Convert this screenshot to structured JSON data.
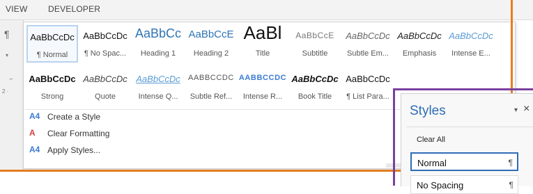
{
  "ribbon": {
    "tabs": [
      "VIEW",
      "DEVELOPER"
    ],
    "left_glyphs": {
      "paragraph": "¶",
      "dropdown": "▾",
      "launcher": "⌐",
      "ruler": "2 ·"
    }
  },
  "gallery": {
    "row1": [
      {
        "preview": "AaBbCcDc",
        "label": "¶ Normal",
        "selected": true
      },
      {
        "preview": "AaBbCcDc",
        "label": "¶ No Spac..."
      },
      {
        "preview": "AaBbCc",
        "label": "Heading 1"
      },
      {
        "preview": "AaBbCcE",
        "label": "Heading 2"
      },
      {
        "preview": "AaBl",
        "label": "Title"
      },
      {
        "preview": "AaBbCcE",
        "label": "Subtitle"
      },
      {
        "preview": "AaBbCcDc",
        "label": "Subtle Em..."
      },
      {
        "preview": "AaBbCcDc",
        "label": "Emphasis"
      },
      {
        "preview": "AaBbCcDc",
        "label": "Intense E..."
      }
    ],
    "row2": [
      {
        "preview": "AaBbCcDc",
        "label": "Strong"
      },
      {
        "preview": "AaBbCcDc",
        "label": "Quote"
      },
      {
        "preview": "AaBbCcDc",
        "label": "Intense Q..."
      },
      {
        "preview": "AABBCCDC",
        "label": "Subtle Ref..."
      },
      {
        "preview": "AABBCCDC",
        "label": "Intense R..."
      },
      {
        "preview": "AaBbCcDc",
        "label": "Book Title"
      },
      {
        "preview": "AaBbCcDc",
        "label": "¶ List Para..."
      }
    ],
    "commands": [
      {
        "icon": "create-style-icon",
        "glyph": "A4",
        "label": "Create a Style"
      },
      {
        "icon": "clear-formatting-icon",
        "glyph": "A",
        "label": "Clear Formatting"
      },
      {
        "icon": "apply-styles-icon",
        "glyph": "A4",
        "label": "Apply Styles..."
      }
    ]
  },
  "styles_pane": {
    "title": "Styles",
    "pin_glyph": "▾",
    "close_glyph": "×",
    "clear_all": "Clear All",
    "items": [
      {
        "label": "Normal",
        "mark": "¶"
      },
      {
        "label": "No Spacing",
        "mark": "¶"
      }
    ]
  },
  "colors": {
    "highlight_orange": "#e57d1f",
    "highlight_purple": "#7b3f9e",
    "accent_blue": "#2e6db5"
  }
}
